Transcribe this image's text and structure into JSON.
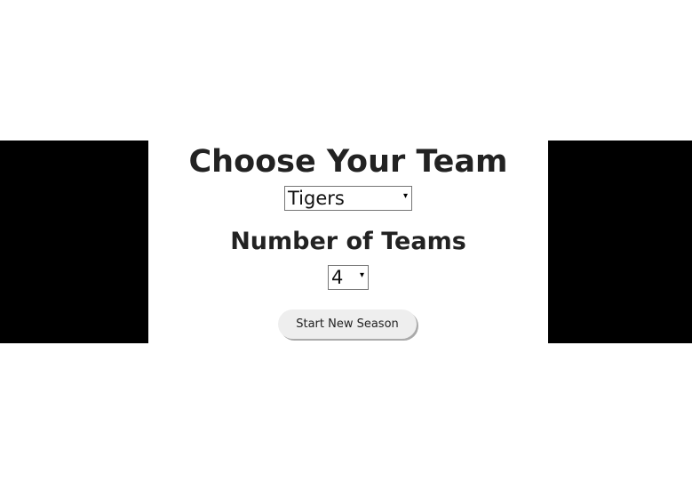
{
  "page": {
    "team_heading": "Choose Your Team",
    "team_select": {
      "selected": "Tigers"
    },
    "count_heading": "Number of Teams",
    "count_select": {
      "selected": "4"
    },
    "start_button_label": "Start New Season"
  },
  "icons": {
    "dropdown": "chevron-down-icon",
    "dropdown_glyph": "▾"
  },
  "colors": {
    "side_panels": "#000000",
    "background": "#ffffff",
    "text": "#222222",
    "button_bg": "#eeeeee"
  }
}
